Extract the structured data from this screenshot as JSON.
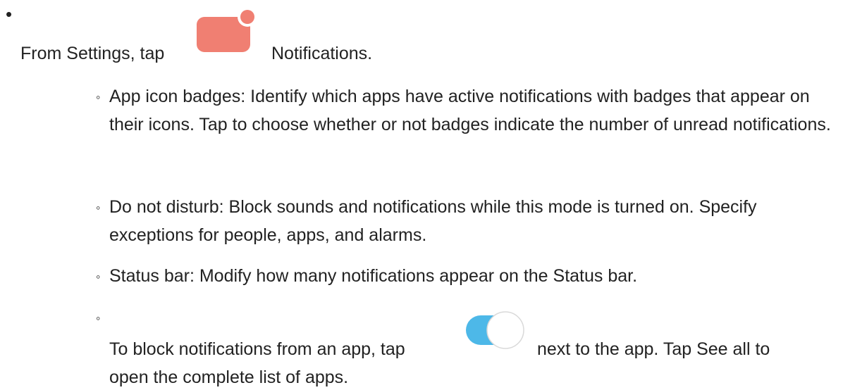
{
  "main_item": {
    "text_before_icon": "From Settings, tap",
    "icon": "notifications-icon",
    "text_after_icon": "Notifications."
  },
  "sub_items": [
    {
      "text": "App icon badges: Identify which apps have active notifications with badges that appear on their icons. Tap to choose whether or not badges indicate the number of unread notifications."
    },
    {
      "text": "Do not disturb: Block sounds and notifications while this mode is turned on. Specify exceptions for people, apps, and alarms."
    },
    {
      "text": "Status bar: Modify how many notifications appear on the Status bar."
    }
  ],
  "block_item": {
    "text_before_icon": "To block notifications from an app, tap",
    "icon": "toggle-switch-icon",
    "text_after_icon": "next to the app. Tap See all to",
    "text_line_2": "open the complete list of apps."
  },
  "colors": {
    "notification_icon": "#f07f72",
    "toggle_track": "#4db8e8",
    "toggle_knob_border": "#d9d9d9",
    "text": "#222222"
  }
}
